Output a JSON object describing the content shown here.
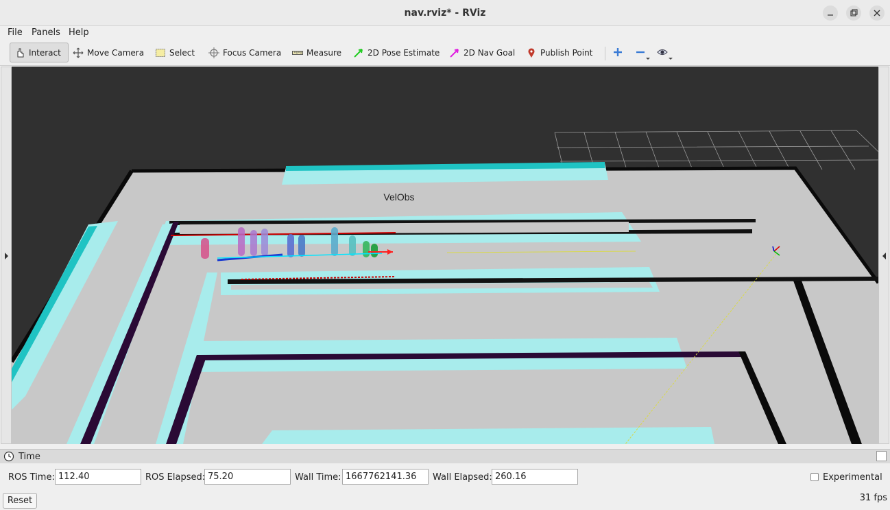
{
  "window": {
    "title": "nav.rviz* - RViz"
  },
  "menubar": {
    "items": [
      "File",
      "Panels",
      "Help"
    ]
  },
  "toolbar": {
    "tools": [
      "Interact",
      "Move Camera",
      "Select",
      "Focus Camera",
      "Measure",
      "2D Pose Estimate",
      "2D Nav Goal",
      "Publish Point"
    ],
    "active_tool": "Interact"
  },
  "viewport": {
    "overlay_text": "VelObs",
    "background_color": "#303030"
  },
  "time_panel": {
    "title": "Time",
    "ros_time_label": "ROS Time:",
    "ros_time": "112.40",
    "ros_elapsed_label": "ROS Elapsed:",
    "ros_elapsed": "75.20",
    "wall_time_label": "Wall Time:",
    "wall_time": "1667762141.36",
    "wall_elapsed_label": "Wall Elapsed:",
    "wall_elapsed": "260.16",
    "experimental_label": "Experimental",
    "experimental_checked": false,
    "reset_label": "Reset",
    "fps": "31 fps"
  }
}
